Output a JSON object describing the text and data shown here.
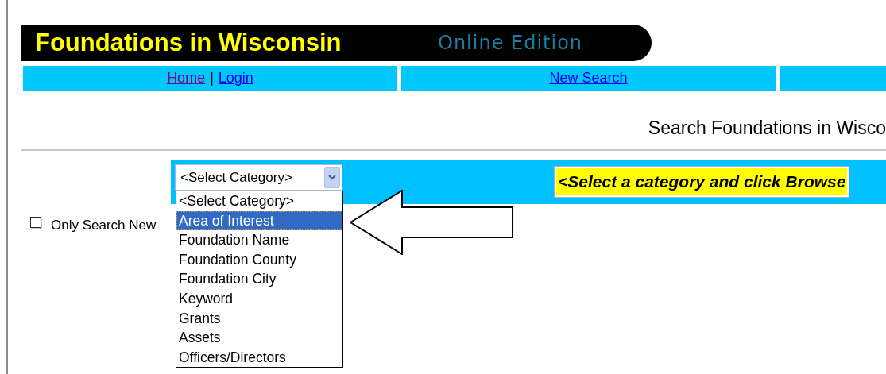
{
  "header": {
    "title": "Foundations in Wisconsin",
    "subtitle": "Online Edition"
  },
  "nav": [
    {
      "links": [
        {
          "label": "Home",
          "visited": true
        },
        {
          "label": "Login",
          "visited": false
        }
      ],
      "separator": "|"
    },
    {
      "links": [
        {
          "label": "New Search",
          "visited": false
        }
      ]
    }
  ],
  "heading": "Search Foundations in Wisco",
  "category_select": {
    "value": "<Select Category>",
    "expanded": true,
    "options": [
      {
        "label": "<Select Category>",
        "highlighted": false
      },
      {
        "label": "Area of Interest",
        "highlighted": true
      },
      {
        "label": "Foundation Name",
        "highlighted": false
      },
      {
        "label": "Foundation County",
        "highlighted": false
      },
      {
        "label": "Foundation City",
        "highlighted": false
      },
      {
        "label": "Keyword",
        "highlighted": false
      },
      {
        "label": "Grants",
        "highlighted": false
      },
      {
        "label": "Assets",
        "highlighted": false
      },
      {
        "label": "Officers/Directors",
        "highlighted": false
      }
    ]
  },
  "hint": "<Select a category and click Browse",
  "only_new": {
    "label": "Only Search New",
    "checked": false
  }
}
